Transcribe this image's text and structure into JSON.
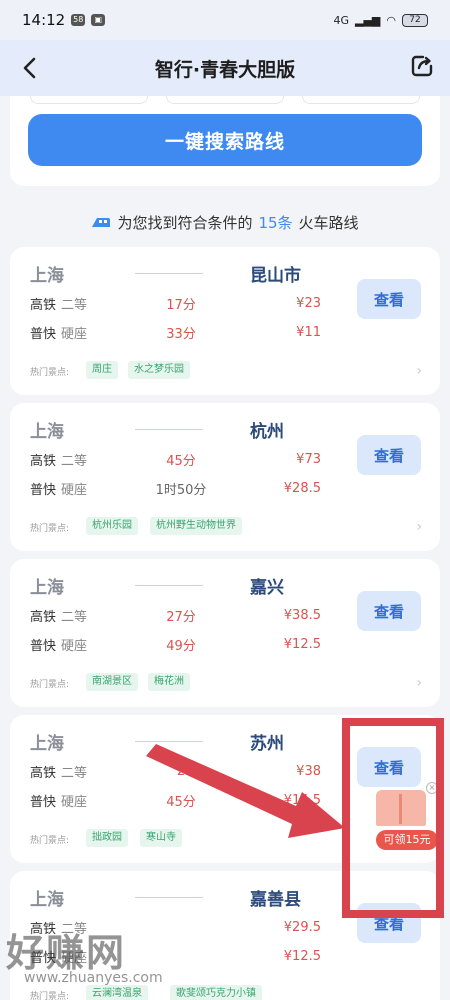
{
  "status": {
    "time": "14:12",
    "badge1": "58",
    "signal": "4G",
    "battery": "72"
  },
  "header": {
    "title": "智行·青春大胆版"
  },
  "search": {
    "button_label": "一键搜索路线"
  },
  "result": {
    "prefix": "为您找到符合条件的",
    "count": "15条",
    "suffix": "火车路线"
  },
  "hot_label": "热门景点:",
  "view_label": "查看",
  "routes": [
    {
      "from": "上海",
      "to": "昆山市",
      "rows": [
        {
          "type": "高铁",
          "seat": "二等",
          "time": "17分",
          "price": "¥23"
        },
        {
          "type": "普快",
          "seat": "硬座",
          "time": "33分",
          "price": "¥11"
        }
      ],
      "tags": [
        "周庄",
        "水之梦乐园"
      ]
    },
    {
      "from": "上海",
      "to": "杭州",
      "rows": [
        {
          "type": "高铁",
          "seat": "二等",
          "time": "45分",
          "price": "¥73"
        },
        {
          "type": "普快",
          "seat": "硬座",
          "time": "1时50分",
          "price": "¥28.5"
        }
      ],
      "tags": [
        "杭州乐园",
        "杭州野生动物世界"
      ]
    },
    {
      "from": "上海",
      "to": "嘉兴",
      "rows": [
        {
          "type": "高铁",
          "seat": "二等",
          "time": "27分",
          "price": "¥38.5"
        },
        {
          "type": "普快",
          "seat": "硬座",
          "time": "49分",
          "price": "¥12.5"
        }
      ],
      "tags": [
        "南湖景区",
        "梅花洲"
      ]
    },
    {
      "from": "上海",
      "to": "苏州",
      "rows": [
        {
          "type": "高铁",
          "seat": "二等",
          "time": "2",
          "price": "¥38"
        },
        {
          "type": "普快",
          "seat": "硬座",
          "time": "45分",
          "price": "¥14.5"
        }
      ],
      "tags": [
        "拙政园",
        "寒山寺"
      ]
    },
    {
      "from": "上海",
      "to": "嘉善县",
      "rows": [
        {
          "type": "高铁",
          "seat": "二等",
          "time": "",
          "price": "¥29.5"
        },
        {
          "type": "普快",
          "seat": "硬座",
          "time": "",
          "price": "¥12.5"
        }
      ],
      "tags": [
        "云澜湾温泉",
        "歌斐颂巧克力小镇"
      ]
    }
  ],
  "ad": {
    "label": "可领15元",
    "close": "×"
  },
  "watermark": {
    "text": "好赚网",
    "url": "www.zhuanyes.com"
  }
}
